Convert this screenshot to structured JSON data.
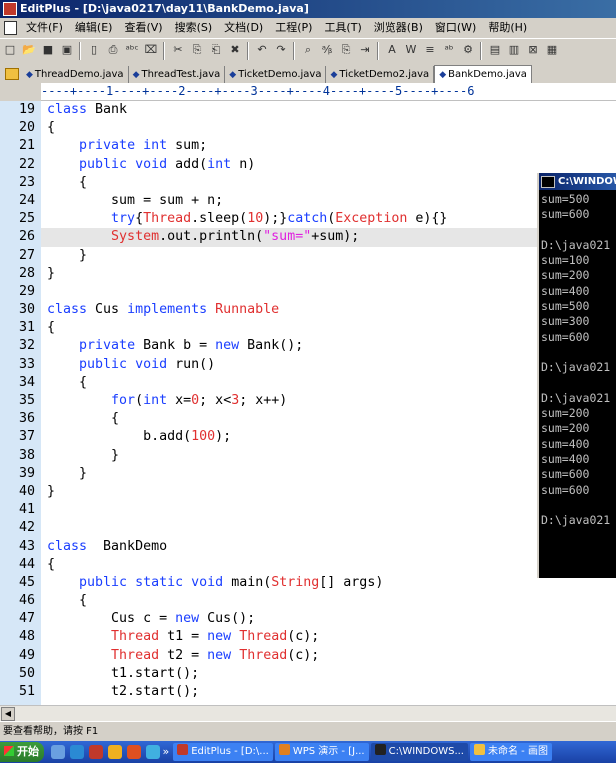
{
  "window": {
    "title": "EditPlus - [D:\\java0217\\day11\\BankDemo.java]"
  },
  "menu": [
    "文件(F)",
    "编辑(E)",
    "查看(V)",
    "搜索(S)",
    "文档(D)",
    "工程(P)",
    "工具(T)",
    "浏览器(B)",
    "窗口(W)",
    "帮助(H)"
  ],
  "toolbar": {
    "icons": [
      "new-icon",
      "open-icon",
      "save-icon",
      "save-all-icon",
      "print-preview-icon",
      "print-icon",
      "spellcheck-icon",
      "browser-icon",
      "cut-icon",
      "copy-icon",
      "paste-icon",
      "delete-icon",
      "undo-icon",
      "redo-icon",
      "find-icon",
      "replace-icon",
      "clipboard-icon",
      "indent-icon",
      "font-icon",
      "word-wrap-icon",
      "ruler-icon",
      "abc-icon",
      "settings-icon",
      "view1-icon",
      "view2-icon",
      "close-doc-icon",
      "view3-icon"
    ],
    "glyphs": [
      "□",
      "📂",
      "■",
      "▣",
      "▯",
      "⎙",
      "ᵃᵇᶜ",
      "⌧",
      "✂",
      "⎘",
      "⎗",
      "✖",
      "↶",
      "↷",
      "⌕",
      "ᵃ⁄ᵦ",
      "⎘",
      "⇥",
      "A",
      "W",
      "≡",
      "ᵃᵇ",
      "⚙",
      "▤",
      "▥",
      "⊠",
      "▦"
    ]
  },
  "tabs": [
    {
      "label": "ThreadDemo.java",
      "active": false
    },
    {
      "label": "ThreadTest.java",
      "active": false
    },
    {
      "label": "TicketDemo.java",
      "active": false
    },
    {
      "label": "TicketDemo2.java",
      "active": false
    },
    {
      "label": "BankDemo.java",
      "active": true
    }
  ],
  "ruler": "----+----1----+----2----+----3----+----4----+----5----+----6",
  "code": {
    "highlight_line": 26,
    "lines": [
      {
        "no": "19",
        "tokens": [
          [
            "k",
            "class"
          ],
          [
            "t",
            " Bank"
          ]
        ]
      },
      {
        "no": "20",
        "tokens": [
          [
            "t",
            "{"
          ]
        ]
      },
      {
        "no": "21",
        "tokens": [
          [
            "t",
            "    "
          ],
          [
            "k",
            "private"
          ],
          [
            "t",
            " "
          ],
          [
            "k",
            "int"
          ],
          [
            "t",
            " sum;"
          ]
        ]
      },
      {
        "no": "22",
        "tokens": [
          [
            "t",
            "    "
          ],
          [
            "k",
            "public"
          ],
          [
            "t",
            " "
          ],
          [
            "k",
            "void"
          ],
          [
            "t",
            " add("
          ],
          [
            "k",
            "int"
          ],
          [
            "t",
            " n)"
          ]
        ]
      },
      {
        "no": "23",
        "tokens": [
          [
            "t",
            "    {"
          ]
        ]
      },
      {
        "no": "24",
        "tokens": [
          [
            "t",
            "        sum = sum + n;"
          ]
        ]
      },
      {
        "no": "25",
        "tokens": [
          [
            "t",
            "        "
          ],
          [
            "k",
            "try"
          ],
          [
            "t",
            "{"
          ],
          [
            "c",
            "Thread"
          ],
          [
            "t",
            ".sleep("
          ],
          [
            "n",
            "10"
          ],
          [
            "t",
            ");}"
          ],
          [
            "k",
            "catch"
          ],
          [
            "t",
            "("
          ],
          [
            "c",
            "Exception"
          ],
          [
            "t",
            " e){}"
          ]
        ]
      },
      {
        "no": "26",
        "tokens": [
          [
            "t",
            "        "
          ],
          [
            "c",
            "System"
          ],
          [
            "t",
            ".out.println("
          ],
          [
            "s",
            "\"sum=\""
          ],
          [
            "t",
            "+sum);"
          ]
        ]
      },
      {
        "no": "27",
        "tokens": [
          [
            "t",
            "    }"
          ]
        ]
      },
      {
        "no": "28",
        "tokens": [
          [
            "t",
            "}"
          ]
        ]
      },
      {
        "no": "29",
        "tokens": [
          [
            "t",
            ""
          ]
        ]
      },
      {
        "no": "30",
        "tokens": [
          [
            "k",
            "class"
          ],
          [
            "t",
            " Cus "
          ],
          [
            "k",
            "implements"
          ],
          [
            "t",
            " "
          ],
          [
            "c",
            "Runnable"
          ]
        ]
      },
      {
        "no": "31",
        "tokens": [
          [
            "t",
            "{"
          ]
        ]
      },
      {
        "no": "32",
        "tokens": [
          [
            "t",
            "    "
          ],
          [
            "k",
            "private"
          ],
          [
            "t",
            " Bank b = "
          ],
          [
            "k",
            "new"
          ],
          [
            "t",
            " Bank();"
          ]
        ]
      },
      {
        "no": "33",
        "tokens": [
          [
            "t",
            "    "
          ],
          [
            "k",
            "public"
          ],
          [
            "t",
            " "
          ],
          [
            "k",
            "void"
          ],
          [
            "t",
            " run()"
          ]
        ]
      },
      {
        "no": "34",
        "tokens": [
          [
            "t",
            "    {"
          ]
        ]
      },
      {
        "no": "35",
        "tokens": [
          [
            "t",
            "        "
          ],
          [
            "k",
            "for"
          ],
          [
            "t",
            "("
          ],
          [
            "k",
            "int"
          ],
          [
            "t",
            " x="
          ],
          [
            "n",
            "0"
          ],
          [
            "t",
            "; x<"
          ],
          [
            "n",
            "3"
          ],
          [
            "t",
            "; x++)"
          ]
        ]
      },
      {
        "no": "36",
        "tokens": [
          [
            "t",
            "        {"
          ]
        ]
      },
      {
        "no": "37",
        "tokens": [
          [
            "t",
            "            b.add("
          ],
          [
            "n",
            "100"
          ],
          [
            "t",
            ");"
          ]
        ]
      },
      {
        "no": "38",
        "tokens": [
          [
            "t",
            "        }"
          ]
        ]
      },
      {
        "no": "39",
        "tokens": [
          [
            "t",
            "    }"
          ]
        ]
      },
      {
        "no": "40",
        "tokens": [
          [
            "t",
            "}"
          ]
        ]
      },
      {
        "no": "41",
        "tokens": [
          [
            "t",
            ""
          ]
        ]
      },
      {
        "no": "42",
        "tokens": [
          [
            "t",
            ""
          ]
        ]
      },
      {
        "no": "43",
        "tokens": [
          [
            "k",
            "class"
          ],
          [
            "t",
            "  BankDemo"
          ]
        ]
      },
      {
        "no": "44",
        "tokens": [
          [
            "t",
            "{"
          ]
        ]
      },
      {
        "no": "45",
        "tokens": [
          [
            "t",
            "    "
          ],
          [
            "k",
            "public"
          ],
          [
            "t",
            " "
          ],
          [
            "k",
            "static"
          ],
          [
            "t",
            " "
          ],
          [
            "k",
            "void"
          ],
          [
            "t",
            " main("
          ],
          [
            "c",
            "String"
          ],
          [
            "t",
            "[] args)"
          ]
        ]
      },
      {
        "no": "46",
        "tokens": [
          [
            "t",
            "    {"
          ]
        ]
      },
      {
        "no": "47",
        "tokens": [
          [
            "t",
            "        Cus c = "
          ],
          [
            "k",
            "new"
          ],
          [
            "t",
            " Cus();"
          ]
        ]
      },
      {
        "no": "48",
        "tokens": [
          [
            "t",
            "        "
          ],
          [
            "c",
            "Thread"
          ],
          [
            "t",
            " t1 = "
          ],
          [
            "k",
            "new"
          ],
          [
            "t",
            " "
          ],
          [
            "c",
            "Thread"
          ],
          [
            "t",
            "(c);"
          ]
        ]
      },
      {
        "no": "49",
        "tokens": [
          [
            "t",
            "        "
          ],
          [
            "c",
            "Thread"
          ],
          [
            "t",
            " t2 = "
          ],
          [
            "k",
            "new"
          ],
          [
            "t",
            " "
          ],
          [
            "c",
            "Thread"
          ],
          [
            "t",
            "(c);"
          ]
        ]
      },
      {
        "no": "50",
        "tokens": [
          [
            "t",
            "        t1.start();"
          ]
        ]
      },
      {
        "no": "51",
        "tokens": [
          [
            "t",
            "        t2.start();"
          ]
        ]
      }
    ]
  },
  "console": {
    "title": "C:\\WINDOWS",
    "lines": [
      "sum=500",
      "sum=600",
      "",
      "D:\\java021",
      "sum=100",
      "sum=200",
      "sum=400",
      "sum=500",
      "sum=300",
      "sum=600",
      "",
      "D:\\java021",
      "",
      "D:\\java021",
      "sum=200",
      "sum=200",
      "sum=400",
      "sum=400",
      "sum=600",
      "sum=600",
      "",
      "D:\\java021"
    ]
  },
  "status": {
    "help": "要查看帮助，请按 F1"
  },
  "taskbar": {
    "start": "开始",
    "quick_icons": [
      {
        "name": "wireless-icon",
        "color": "#6aa0e0"
      },
      {
        "name": "ie-icon",
        "color": "#2a8ad4"
      },
      {
        "name": "editplus-quick-icon",
        "color": "#c0392b"
      },
      {
        "name": "tool-quick-icon",
        "color": "#f0b020"
      },
      {
        "name": "media-quick-icon",
        "color": "#e05020"
      },
      {
        "name": "messenger-quick-icon",
        "color": "#40b0e0"
      }
    ],
    "tasks": [
      {
        "label": "EditPlus - [D:\\...",
        "color": "#c0392b",
        "active": false
      },
      {
        "label": "WPS 演示 - [J...",
        "color": "#e08020",
        "active": false
      },
      {
        "label": "C:\\WINDOWS...",
        "color": "#222222",
        "active": true
      },
      {
        "label": "未命名 - 画图",
        "color": "#f0c040",
        "active": false
      }
    ]
  }
}
